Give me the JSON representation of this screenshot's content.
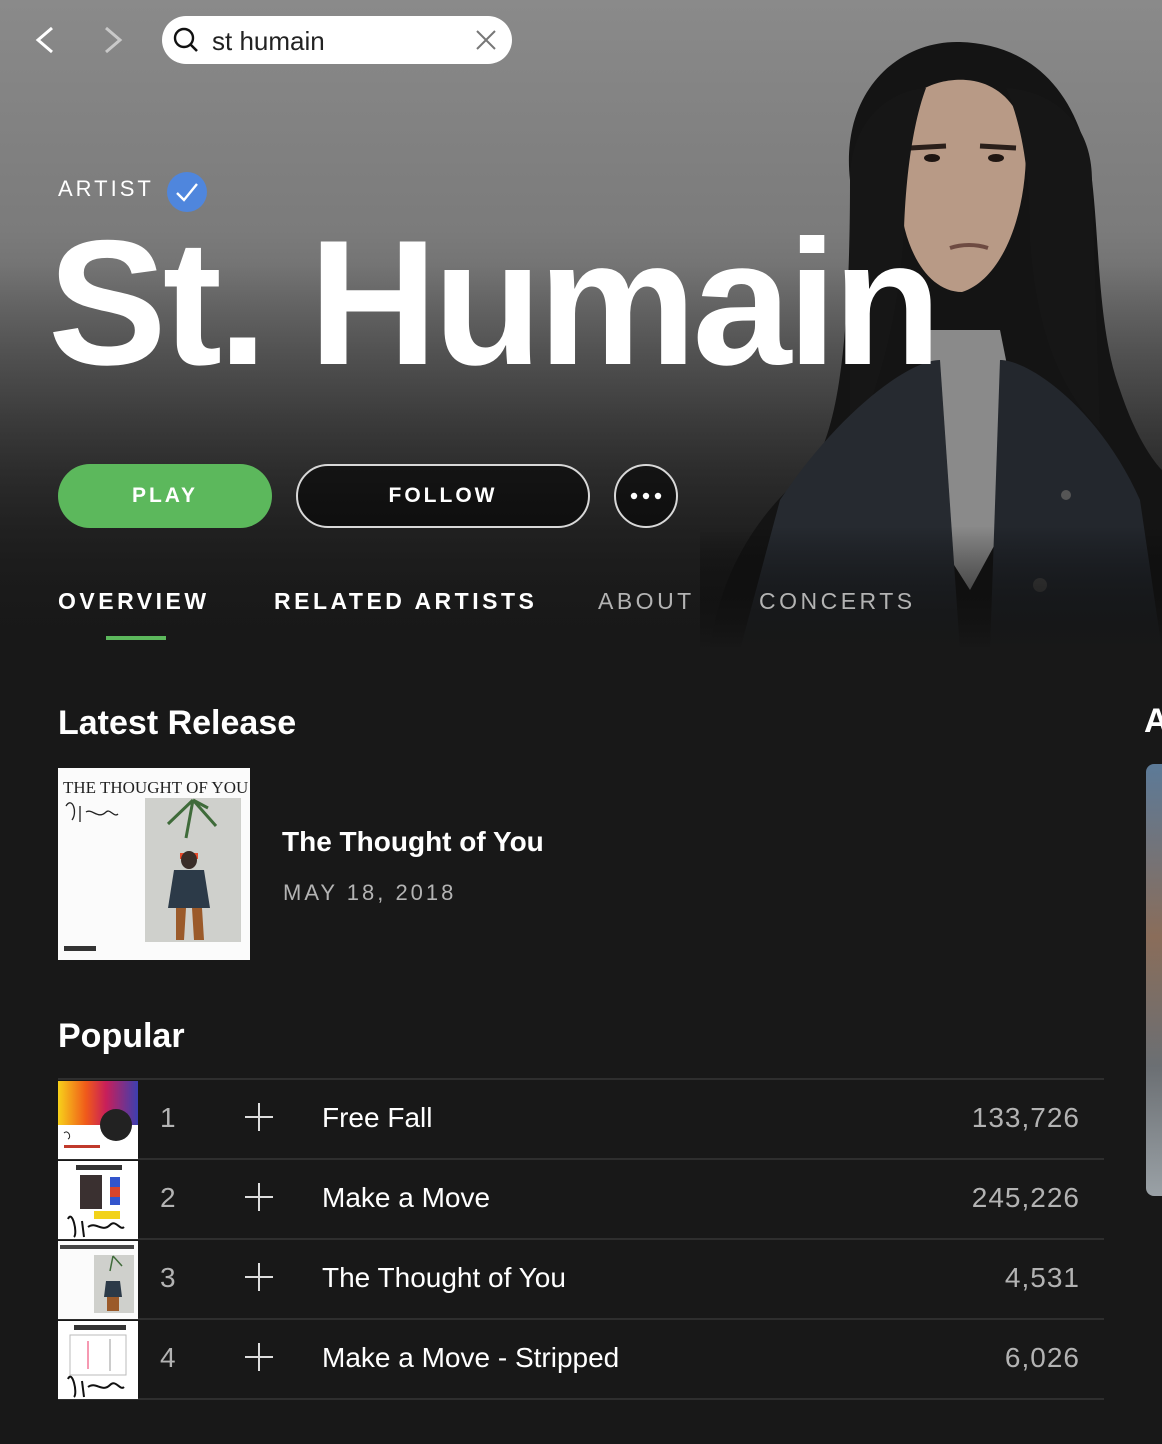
{
  "search": {
    "value": "st humain"
  },
  "artist": {
    "kicker": "ARTIST",
    "name": "St. Humain",
    "verified": true,
    "accent_color": "#5cb85c",
    "verified_color": "#4f86dd"
  },
  "actions": {
    "play": "PLAY",
    "follow": "FOLLOW",
    "more_icon": "ellipsis-icon"
  },
  "tabs": [
    {
      "label": "OVERVIEW",
      "active": true
    },
    {
      "label": "RELATED ARTISTS",
      "active": false
    },
    {
      "label": "ABOUT",
      "active": false
    },
    {
      "label": "CONCERTS",
      "active": false
    }
  ],
  "latest_release": {
    "heading": "Latest Release",
    "title": "The Thought of You",
    "date": "MAY 18, 2018",
    "cover_text": "THE THOUGHT OF YOU"
  },
  "side_heading_peek": "A",
  "popular": {
    "heading": "Popular",
    "tracks": [
      {
        "num": "1",
        "title": "Free Fall",
        "plays": "133,726"
      },
      {
        "num": "2",
        "title": "Make a Move",
        "plays": "245,226"
      },
      {
        "num": "3",
        "title": "The Thought of You",
        "plays": "4,531"
      },
      {
        "num": "4",
        "title": "Make a Move - Stripped",
        "plays": "6,026"
      }
    ]
  }
}
